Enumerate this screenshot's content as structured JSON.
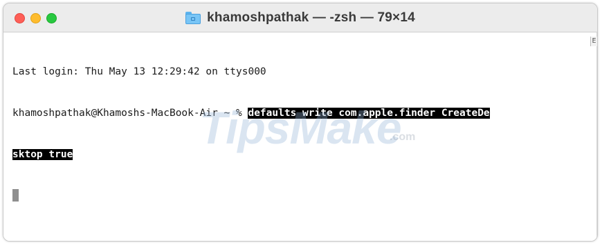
{
  "window": {
    "title": "khamoshpathak — -zsh — 79×14",
    "title_icon": "folder-icon",
    "traffic_lights": {
      "close_color": "#fe5f57",
      "minimize_color": "#febc2e",
      "zoom_color": "#28c840"
    }
  },
  "terminal": {
    "last_login": "Last login: Thu May 13 12:29:42 on ttys000",
    "prompt": "khamoshpathak@Khamoshs-MacBook-Air ~ % ",
    "command_line1": "defaults write com.apple.finder CreateDe",
    "command_line2": "sktop true",
    "scroll_marker": "E"
  },
  "watermark": {
    "text": "TipsMake",
    "suffix": ".com"
  }
}
